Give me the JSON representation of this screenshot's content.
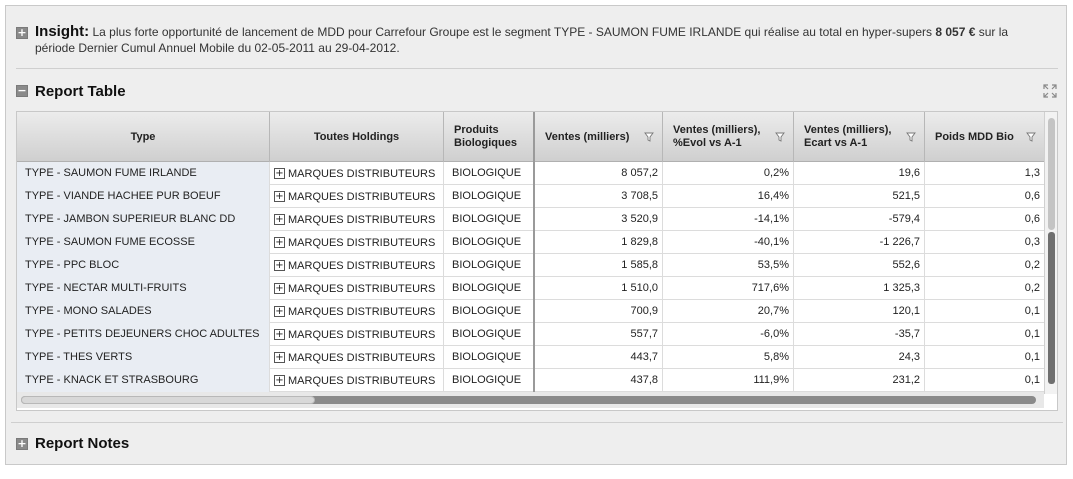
{
  "insight": {
    "title": "Insight:",
    "text_before": "La plus forte opportunité de lancement de MDD pour Carrefour Groupe est le segment TYPE - SAUMON FUME IRLANDE qui réalise au total en hyper-supers",
    "value": "8 057 €",
    "text_after": "sur la période Dernier Cumul Annuel Mobile du 02-05-2011 au 29-04-2012."
  },
  "report_table": {
    "title": "Report Table",
    "columns": [
      {
        "label": "Type"
      },
      {
        "label": "Toutes Holdings"
      },
      {
        "label": "Produits Biologiques"
      },
      {
        "label": "Ventes (milliers)"
      },
      {
        "label": "Ventes (milliers), %Evol vs A-1"
      },
      {
        "label": "Ventes (milliers), Ecart vs A-1"
      },
      {
        "label": "Poids MDD Bio"
      }
    ],
    "rows": [
      {
        "type": "TYPE - SAUMON FUME IRLANDE",
        "holding": "MARQUES DISTRIBUTEURS",
        "bio": "BIOLOGIQUE",
        "ventes": "8 057,2",
        "evol": "0,2%",
        "ecart": "19,6",
        "poids": "1,3"
      },
      {
        "type": "TYPE - VIANDE HACHEE PUR BOEUF",
        "holding": "MARQUES DISTRIBUTEURS",
        "bio": "BIOLOGIQUE",
        "ventes": "3 708,5",
        "evol": "16,4%",
        "ecart": "521,5",
        "poids": "0,6"
      },
      {
        "type": "TYPE - JAMBON SUPERIEUR BLANC DD",
        "holding": "MARQUES DISTRIBUTEURS",
        "bio": "BIOLOGIQUE",
        "ventes": "3 520,9",
        "evol": "-14,1%",
        "ecart": "-579,4",
        "poids": "0,6"
      },
      {
        "type": "TYPE - SAUMON FUME ECOSSE",
        "holding": "MARQUES DISTRIBUTEURS",
        "bio": "BIOLOGIQUE",
        "ventes": "1 829,8",
        "evol": "-40,1%",
        "ecart": "-1 226,7",
        "poids": "0,3"
      },
      {
        "type": "TYPE - PPC BLOC",
        "holding": "MARQUES DISTRIBUTEURS",
        "bio": "BIOLOGIQUE",
        "ventes": "1 585,8",
        "evol": "53,5%",
        "ecart": "552,6",
        "poids": "0,2"
      },
      {
        "type": "TYPE - NECTAR MULTI-FRUITS",
        "holding": "MARQUES DISTRIBUTEURS",
        "bio": "BIOLOGIQUE",
        "ventes": "1 510,0",
        "evol": "717,6%",
        "ecart": "1 325,3",
        "poids": "0,2"
      },
      {
        "type": "TYPE - MONO SALADES",
        "holding": "MARQUES DISTRIBUTEURS",
        "bio": "BIOLOGIQUE",
        "ventes": "700,9",
        "evol": "20,7%",
        "ecart": "120,1",
        "poids": "0,1"
      },
      {
        "type": "TYPE - PETITS DEJEUNERS CHOC ADULTES",
        "holding": "MARQUES DISTRIBUTEURS",
        "bio": "BIOLOGIQUE",
        "ventes": "557,7",
        "evol": "-6,0%",
        "ecart": "-35,7",
        "poids": "0,1"
      },
      {
        "type": "TYPE - THES VERTS",
        "holding": "MARQUES DISTRIBUTEURS",
        "bio": "BIOLOGIQUE",
        "ventes": "443,7",
        "evol": "5,8%",
        "ecart": "24,3",
        "poids": "0,1"
      },
      {
        "type": "TYPE - KNACK ET STRASBOURG",
        "holding": "MARQUES DISTRIBUTEURS",
        "bio": "BIOLOGIQUE",
        "ventes": "437,8",
        "evol": "111,9%",
        "ecart": "231,2",
        "poids": "0,1"
      }
    ]
  },
  "report_notes": {
    "title": "Report Notes"
  },
  "icons": {
    "section_toggle_plus": "plus-square-icon",
    "section_toggle_minus": "minus-square-icon",
    "expand": "expand-arrows-icon",
    "filter": "filter-funnel-icon",
    "row_expand": "plus-box-icon"
  },
  "colors": {
    "panel_bg": "#eeeeee",
    "header_gradient_top": "#ececec",
    "header_gradient_bottom": "#cfcfcf",
    "type_cell_bg": "#e9edf3",
    "toggle_gray": "#8a8a8a"
  }
}
